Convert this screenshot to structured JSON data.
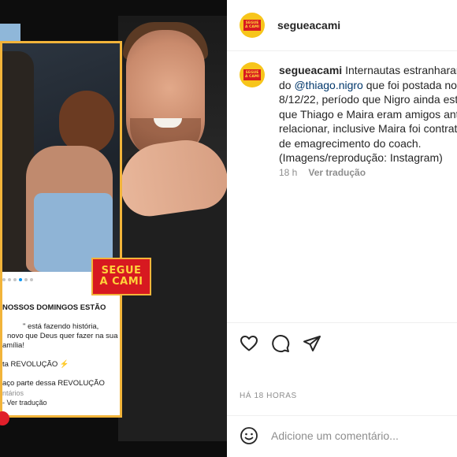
{
  "post": {
    "username": "segueacami",
    "avatar_text": [
      "SEGUE",
      "A CAMI"
    ],
    "caption_lines": [
      {
        "pre": "Internautas estranharam",
        "mention": "",
        "post": ""
      },
      {
        "pre": "do ",
        "mention": "@thiago.nigro",
        "post": " que foi postada no"
      },
      {
        "pre": "8/12/22, período que Nigro ainda est",
        "mention": "",
        "post": ""
      },
      {
        "pre": "que Thiago e Maira eram amigos ant",
        "mention": "",
        "post": ""
      },
      {
        "pre": "relacionar, inclusive Maira foi contrat",
        "mention": "",
        "post": ""
      },
      {
        "pre": "de emagrecimento do coach.",
        "mention": "",
        "post": ""
      },
      {
        "pre": "(Imagens/reprodução: Instagram)",
        "mention": "",
        "post": ""
      }
    ],
    "caption_age": "18 h",
    "translate_label": "Ver tradução",
    "timestamp": "HÁ 18 HORAS",
    "comment_placeholder": "Adicione um comentário..."
  },
  "media": {
    "logo_text": [
      "SEGUE",
      "A CAMI"
    ],
    "card_lines": [
      "NOSSOS DOMINGOS ESTÃO",
      "",
      "\" está fazendo história,",
      "novo que Deus quer fazer na sua",
      "amília!",
      "",
      "ta REVOLUÇÃO ⚡",
      "",
      "aço parte dessa REVOLUÇÃO",
      "ntários",
      "- Ver tradução"
    ]
  },
  "colors": {
    "accent_link": "#00376b",
    "brand_red": "#d71920",
    "brand_yellow": "#f7c51b",
    "pagination_active": "#0095f6"
  },
  "icons": [
    "heart-icon",
    "comment-icon",
    "share-icon",
    "emoji-icon"
  ]
}
